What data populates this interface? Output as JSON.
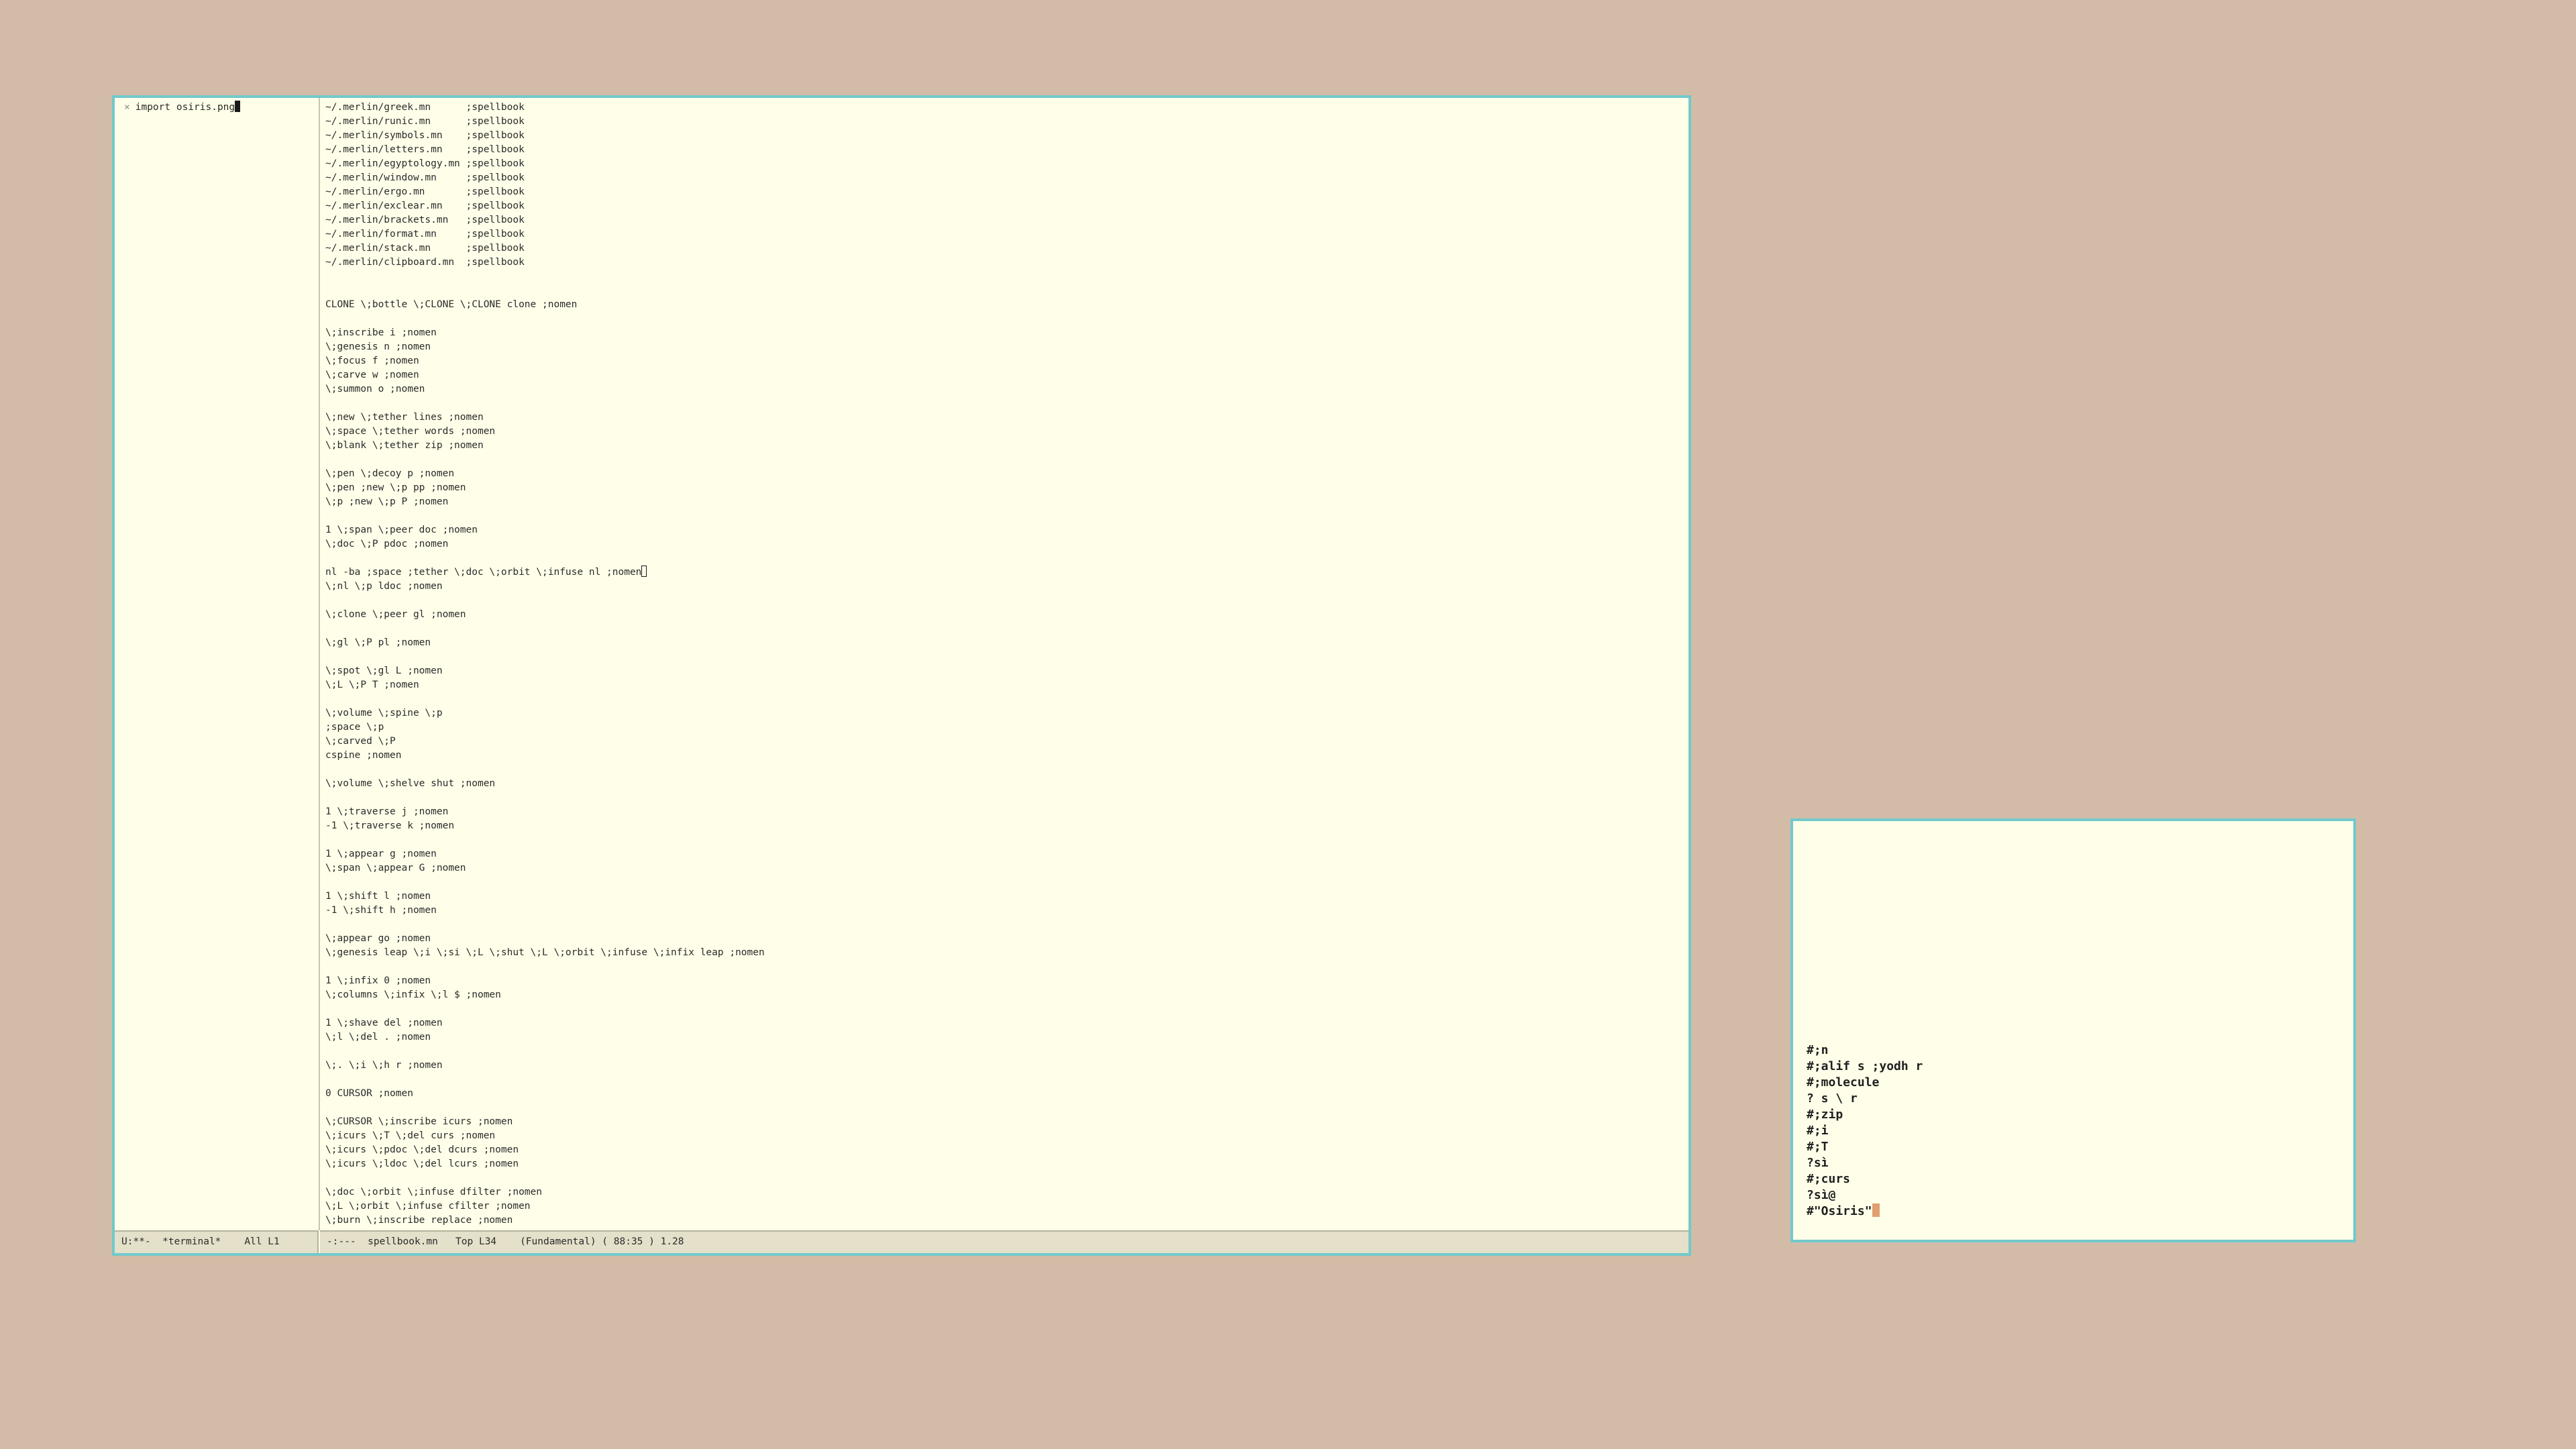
{
  "emacs": {
    "left_buffer": {
      "close_glyph": "×",
      "prompt_text": "import osiris.png"
    },
    "left_modeline": "U:**-  *terminal*    All L1",
    "right_modeline": "-:---  spellbook.mn   Top L34    (Fundamental) ( 88:35 ) 1.28",
    "lines": [
      "~/.merlin/greek.mn      ;spellbook",
      "~/.merlin/runic.mn      ;spellbook",
      "~/.merlin/symbols.mn    ;spellbook",
      "~/.merlin/letters.mn    ;spellbook",
      "~/.merlin/egyptology.mn ;spellbook",
      "~/.merlin/window.mn     ;spellbook",
      "~/.merlin/ergo.mn       ;spellbook",
      "~/.merlin/exclear.mn    ;spellbook",
      "~/.merlin/brackets.mn   ;spellbook",
      "~/.merlin/format.mn     ;spellbook",
      "~/.merlin/stack.mn      ;spellbook",
      "~/.merlin/clipboard.mn  ;spellbook",
      "",
      "",
      "CLONE \\;bottle \\;CLONE \\;CLONE clone ;nomen",
      "",
      "\\;inscribe i ;nomen",
      "\\;genesis n ;nomen",
      "\\;focus f ;nomen",
      "\\;carve w ;nomen",
      "\\;summon o ;nomen",
      "",
      "\\;new \\;tether lines ;nomen",
      "\\;space \\;tether words ;nomen",
      "\\;blank \\;tether zip ;nomen",
      "",
      "\\;pen \\;decoy p ;nomen",
      "\\;pen ;new \\;p pp ;nomen",
      "\\;p ;new \\;p P ;nomen",
      "",
      "1 \\;span \\;peer doc ;nomen",
      "\\;doc \\;P pdoc ;nomen",
      "",
      "nl -ba ;space ;tether \\;doc \\;orbit \\;infuse nl ;nomen",
      "\\;nl \\;p ldoc ;nomen",
      "",
      "\\;clone \\;peer gl ;nomen",
      "",
      "\\;gl \\;P pl ;nomen",
      "",
      "\\;spot \\;gl L ;nomen",
      "\\;L \\;P T ;nomen",
      "",
      "\\;volume \\;spine \\;p",
      ";space \\;p",
      "\\;carved \\;P",
      "cspine ;nomen",
      "",
      "\\;volume \\;shelve shut ;nomen",
      "",
      "1 \\;traverse j ;nomen",
      "-1 \\;traverse k ;nomen",
      "",
      "1 \\;appear g ;nomen",
      "\\;span \\;appear G ;nomen",
      "",
      "1 \\;shift l ;nomen",
      "-1 \\;shift h ;nomen",
      "",
      "\\;appear go ;nomen",
      "\\;genesis leap \\;i \\;si \\;L \\;shut \\;L \\;orbit \\;infuse \\;infix leap ;nomen",
      "",
      "1 \\;infix 0 ;nomen",
      "\\;columns \\;infix \\;l $ ;nomen",
      "",
      "1 \\;shave del ;nomen",
      "\\;l \\;del . ;nomen",
      "",
      "\\;. \\;i \\;h r ;nomen",
      "",
      "0 CURSOR ;nomen",
      "",
      "\\;CURSOR \\;inscribe icurs ;nomen",
      "\\;icurs \\;T \\;del curs ;nomen",
      "\\;icurs \\;pdoc \\;del dcurs ;nomen",
      "\\;icurs \\;ldoc \\;del lcurs ;nomen",
      "",
      "\\;doc \\;orbit \\;infuse dfilter ;nomen",
      "\\;L \\;orbit \\;infuse cfilter ;nomen",
      "\\;burn \\;inscribe replace ;nomen"
    ]
  },
  "terminal": {
    "lines": [
      "#;n",
      "#;alif s ;yodh r",
      "#;molecule",
      "? s \\ r",
      "#;zip",
      "#;i",
      "#;T",
      "?sì",
      "#;curs",
      "?sì@",
      "#\"Osiris\""
    ]
  }
}
